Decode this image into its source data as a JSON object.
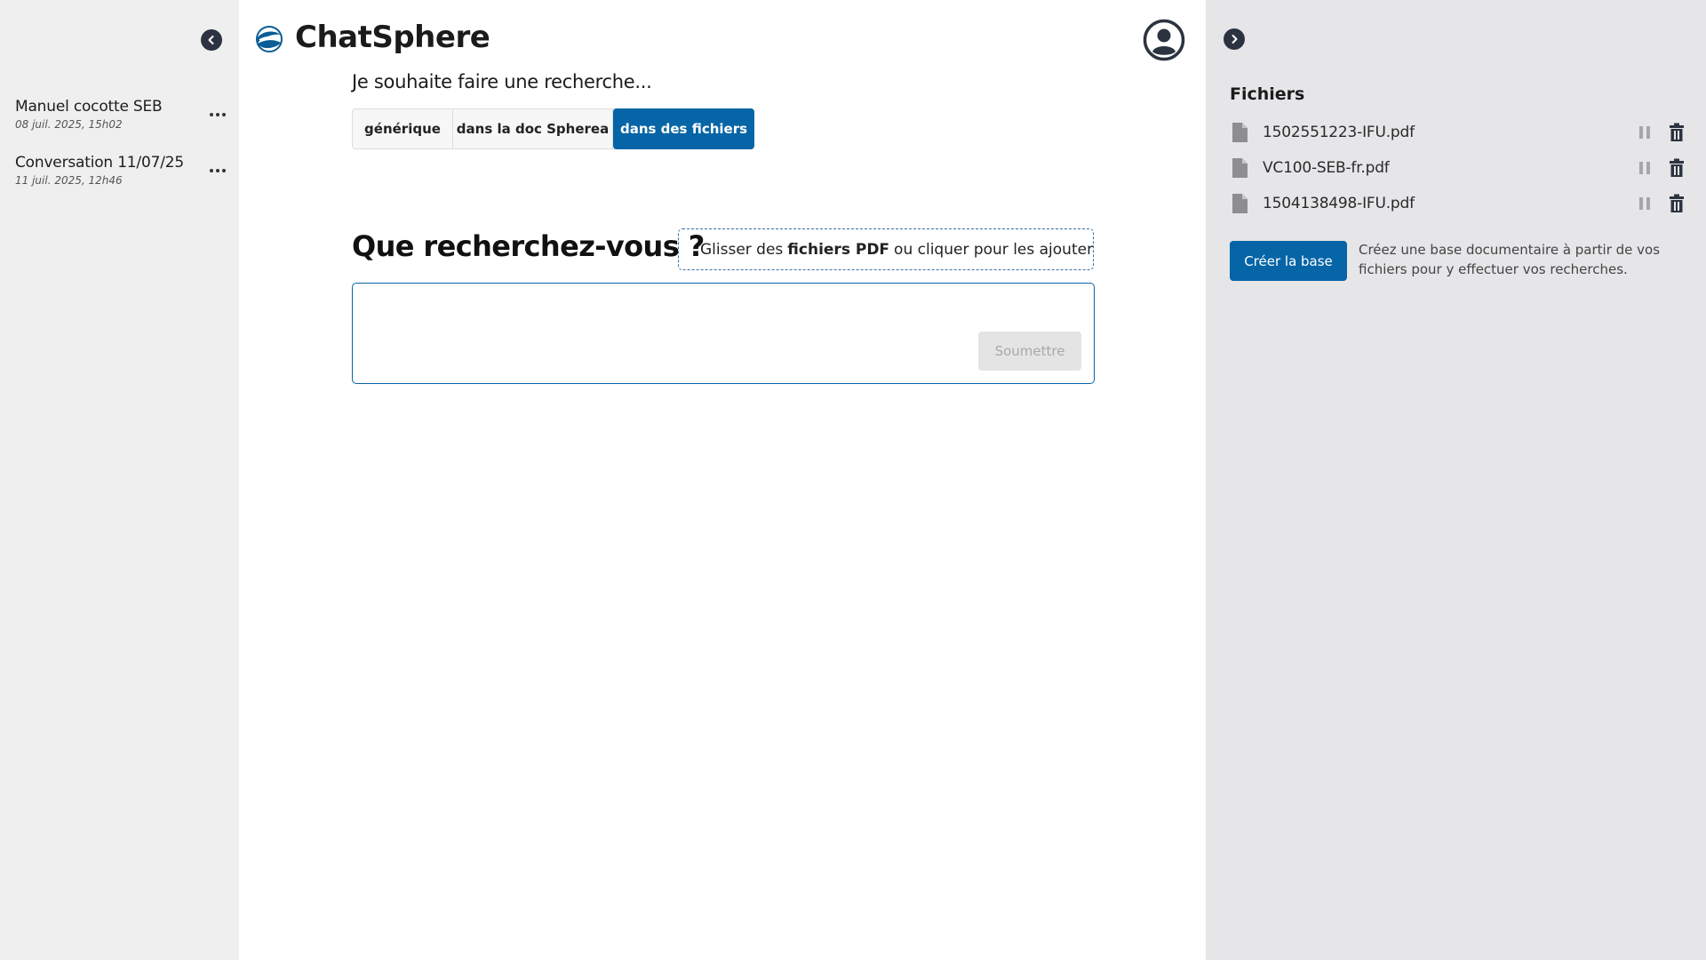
{
  "app": {
    "title": "ChatSphere"
  },
  "sidebar": {
    "conversations": [
      {
        "title": "Manuel cocotte SEB",
        "date": "08 juil. 2025, 15h02"
      },
      {
        "title": "Conversation 11/07/25",
        "date": "11 juil. 2025, 12h46"
      }
    ]
  },
  "search_mode": {
    "heading": "Je souhaite faire une recherche...",
    "options": [
      "générique",
      "dans la doc Spherea",
      "dans des fichiers"
    ],
    "selected": "dans des fichiers"
  },
  "query": {
    "heading": "Que recherchez-vous ?",
    "dropzone": {
      "prefix": "Glisser des",
      "bold": "fichiers PDF",
      "suffix": "ou cliquer pour les ajouter"
    },
    "input_value": "",
    "submit_label": "Soumettre"
  },
  "files_panel": {
    "title": "Fichiers",
    "files": [
      {
        "name": "1502551223-IFU.pdf"
      },
      {
        "name": "VC100-SEB-fr.pdf"
      },
      {
        "name": "1504138498-IFU.pdf"
      }
    ],
    "create_label": "Créer la base",
    "create_hint": "Créez une base documentaire à partir de vos fichiers pour y effectuer vos recherches."
  },
  "colors": {
    "accent": "#0665a6",
    "sidebar_bg": "#efefef",
    "right_panel_bg": "#e6e6e9",
    "icon_dark": "#2c3340"
  },
  "icons": {
    "left_collapse": "chevron-left-icon",
    "right_collapse": "chevron-right-icon",
    "logo": "sphere-logo-icon",
    "user": "user-circle-icon",
    "conversation_menu": "more-horizontal-icon",
    "add": "plus-icon",
    "file": "file-icon",
    "pause": "pause-icon",
    "delete": "trash-icon"
  }
}
